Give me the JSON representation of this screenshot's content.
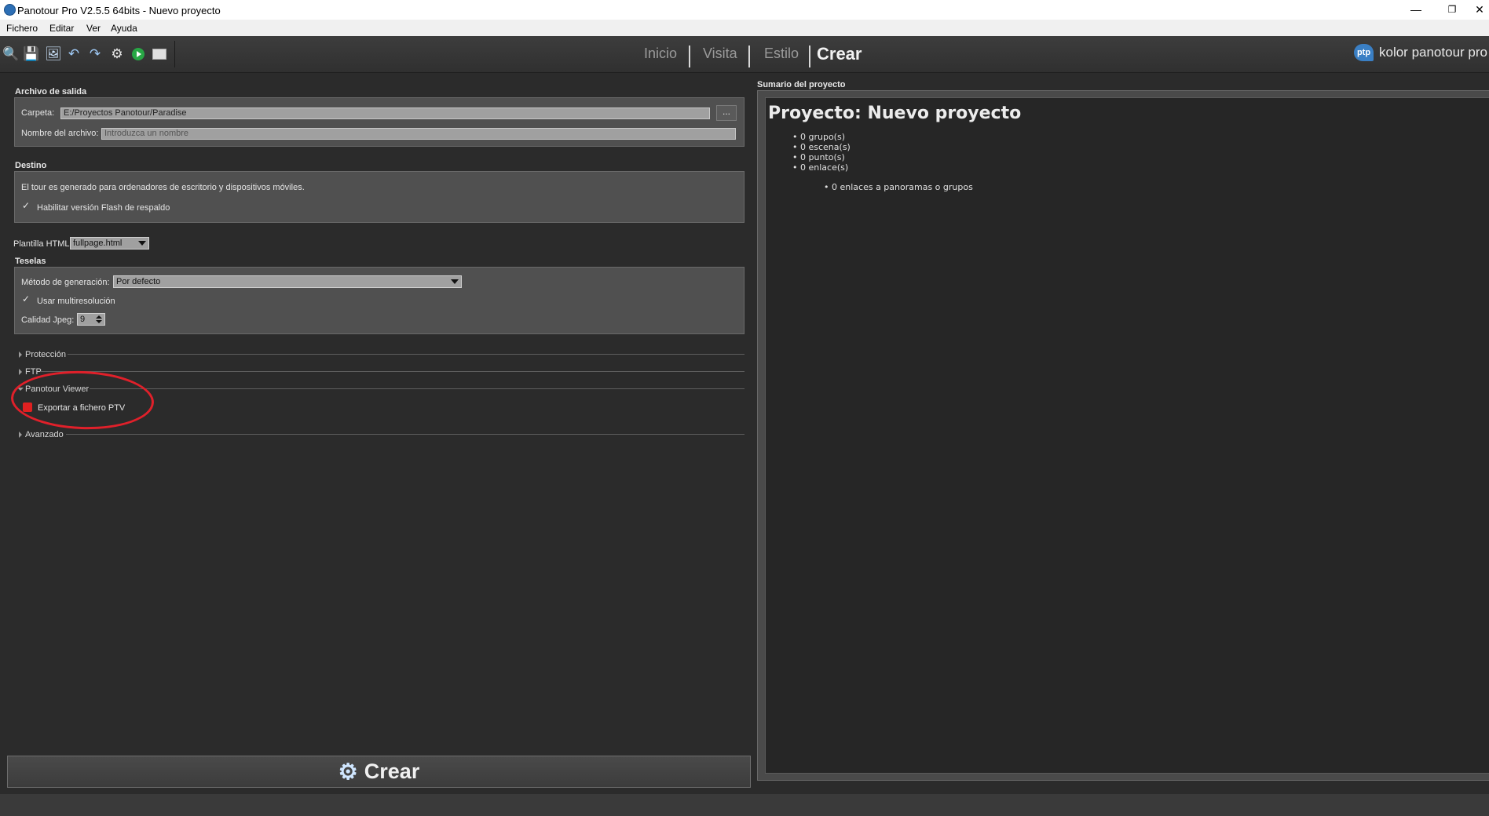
{
  "window": {
    "title": "Panotour Pro V2.5.5 64bits - Nuevo proyecto",
    "minimize": "—",
    "restore": "❐",
    "close": "✕"
  },
  "menu": [
    "Fichero",
    "Editar",
    "Ver",
    "Ayuda"
  ],
  "toolbar": {
    "icons": [
      "add-panorama-icon",
      "save-icon",
      "add-image-icon",
      "undo-icon",
      "redo-icon",
      "settings-icon",
      "play-icon",
      "folder-icon"
    ]
  },
  "tabs": [
    "Inicio",
    "Visita",
    "Estilo",
    "Crear"
  ],
  "active_tab": "Crear",
  "brand": {
    "logo": "ptp",
    "text": "kolor panotour pro"
  },
  "output": {
    "section_title": "Archivo de salida",
    "folder_label": "Carpeta:",
    "folder_value": "E:/Proyectos Panotour/Paradise",
    "browse_label": "...",
    "filename_label": "Nombre del archivo:",
    "filename_placeholder": "Introduzca un nombre"
  },
  "destination": {
    "section_title": "Destino",
    "description": "El tour es generado para ordenadores de escritorio y dispositivos móviles.",
    "flash_label": "Habilitar versión Flash de respaldo",
    "flash_checked": true
  },
  "template": {
    "label": "Plantilla HTML",
    "value": "fullpage.html"
  },
  "tiles": {
    "section_title": "Teselas",
    "method_label": "Método de generación:",
    "method_value": "Por defecto",
    "multires_label": "Usar multiresolución",
    "multires_checked": true,
    "jpeg_label": "Calidad Jpeg:",
    "jpeg_value": "9"
  },
  "sections": {
    "protection": "Protección",
    "ftp": "FTP",
    "viewer": "Panotour Viewer",
    "export_ptv": "Exportar a fichero PTV",
    "advanced": "Avanzado"
  },
  "create_button": {
    "label": "Crear"
  },
  "summary": {
    "section_title": "Sumario del proyecto",
    "title": "Proyecto: Nuevo proyecto",
    "items": [
      "0 grupo(s)",
      "0 escena(s)",
      "0 punto(s)",
      "0 enlace(s)"
    ],
    "sub_item": "0 enlaces a panoramas o grupos"
  },
  "colors": {
    "background": "#2b2b2b",
    "annotation": "#e0202a",
    "brand_blue": "#3a7fc4"
  }
}
